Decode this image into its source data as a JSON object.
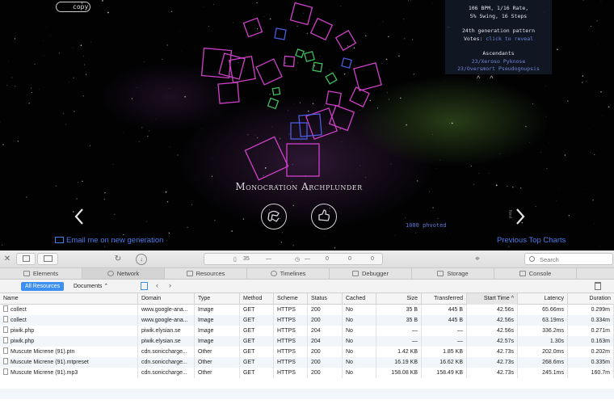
{
  "page": {
    "copy_label": "copy",
    "info": {
      "tempo_line1": "106 BPM, 1/16 Rate,",
      "tempo_line2": "5% Swing, 16 Steps",
      "generation": "24th generation pattern",
      "votes_label": "Votes:",
      "votes_link": "click to reveal",
      "ascendants_title": "Ascendants",
      "ascendants": [
        "23/Xeroso Pyknose",
        "23/Oversmort Pseudognupsis"
      ]
    },
    "song_title": "Monocration Archplunder",
    "play_count": "1000 phvoted",
    "side_label": "Next",
    "email_link": "Email me on new generation",
    "previous_charts": "Previous Top Charts"
  },
  "devtools": {
    "toolbar": {
      "resource_count": "35",
      "dash1": "—",
      "dash2": "—",
      "c1": "0",
      "c2": "0",
      "c3": "0",
      "search_placeholder": "Search"
    },
    "tabs": [
      "Elements",
      "Network",
      "Resources",
      "Timelines",
      "Debugger",
      "Storage",
      "Console"
    ],
    "active_tab": "Network",
    "filters": {
      "all_resources": "All Resources",
      "documents": "Documents ⌃"
    },
    "columns": [
      "Name",
      "Domain",
      "Type",
      "Method",
      "Scheme",
      "Status",
      "Cached",
      "Size",
      "Transferred",
      "Start Time ^",
      "Latency",
      "Duration"
    ],
    "rows": [
      {
        "name": "collect",
        "domain": "www.google-ana...",
        "type": "Image",
        "method": "GET",
        "scheme": "HTTPS",
        "status": "200",
        "cached": "No",
        "size": "35 B",
        "transferred": "445 B",
        "start": "42.56s",
        "latency": "65.66ms",
        "duration": "0.299m"
      },
      {
        "name": "collect",
        "domain": "www.google-ana...",
        "type": "Image",
        "method": "GET",
        "scheme": "HTTPS",
        "status": "200",
        "cached": "No",
        "size": "35 B",
        "transferred": "445 B",
        "start": "42.56s",
        "latency": "63.19ms",
        "duration": "0.334m"
      },
      {
        "name": "piwik.php",
        "domain": "piwik.elysian.se",
        "type": "Image",
        "method": "GET",
        "scheme": "HTTPS",
        "status": "204",
        "cached": "No",
        "size": "—",
        "transferred": "—",
        "start": "42.56s",
        "latency": "336.2ms",
        "duration": "0.271m"
      },
      {
        "name": "piwik.php",
        "domain": "piwik.elysian.se",
        "type": "Image",
        "method": "GET",
        "scheme": "HTTPS",
        "status": "204",
        "cached": "No",
        "size": "—",
        "transferred": "—",
        "start": "42.57s",
        "latency": "1.30s",
        "duration": "0.163m"
      },
      {
        "name": "Muscute Micrene (91).ptn",
        "domain": "cdn.soniccharge...",
        "type": "Other",
        "method": "GET",
        "scheme": "HTTPS",
        "status": "200",
        "cached": "No",
        "size": "1.42 KB",
        "transferred": "1.85 KB",
        "start": "42.73s",
        "latency": "202.0ms",
        "duration": "0.202m"
      },
      {
        "name": "Muscute Micrene (91).mtpreset",
        "domain": "cdn.soniccharge...",
        "type": "Other",
        "method": "GET",
        "scheme": "HTTPS",
        "status": "200",
        "cached": "No",
        "size": "16.19 KB",
        "transferred": "16.62 KB",
        "start": "42.73s",
        "latency": "268.6ms",
        "duration": "0.335m"
      },
      {
        "name": "Muscute Micrene (91).mp3",
        "domain": "cdn.soniccharge...",
        "type": "Other",
        "method": "GET",
        "scheme": "HTTPS",
        "status": "200",
        "cached": "No",
        "size": "158.08 KB",
        "transferred": "158.49 KB",
        "start": "42.73s",
        "latency": "245.1ms",
        "duration": "160.7m"
      }
    ]
  },
  "colors": {
    "link_blue": "#4b7bea",
    "accent_pink": "#d040c8",
    "accent_green": "#3fc060",
    "accent_blue": "#4a5ee0"
  }
}
